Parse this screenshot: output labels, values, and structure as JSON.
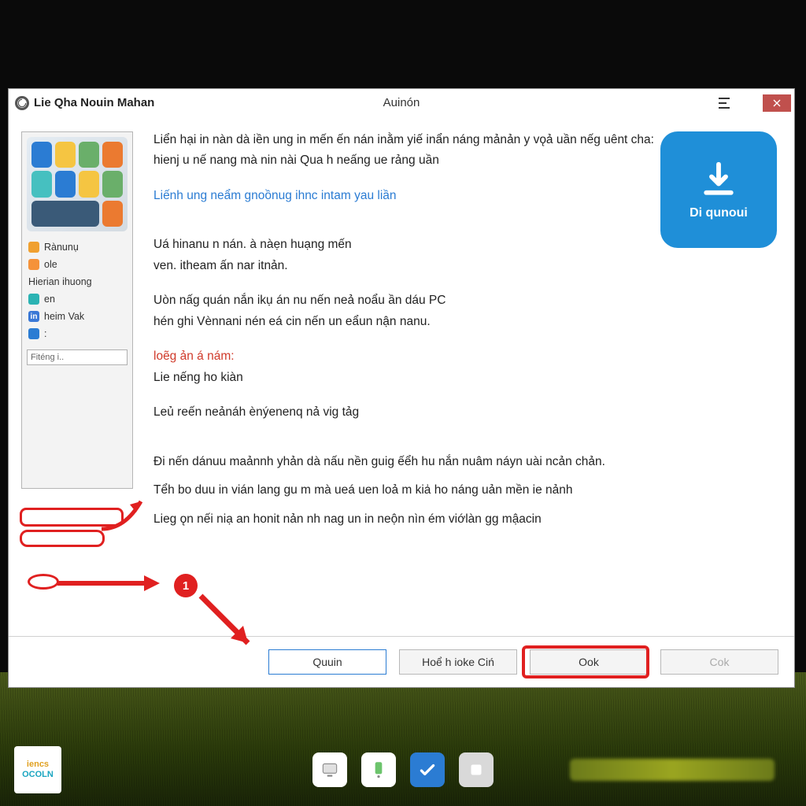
{
  "titlebar": {
    "app_title": "Lie Qha Nouin Mahan",
    "center_title": "Auinón"
  },
  "sidebar": {
    "items": [
      {
        "label": "Rànunụ"
      },
      {
        "label": "ole"
      },
      {
        "label": "Hierian ihuong"
      },
      {
        "label": "en"
      },
      {
        "label": "heim Vak"
      },
      {
        "label": ":"
      }
    ],
    "field_label": "Fiténg i.."
  },
  "content": {
    "p1": "Liển hại in nàn dà iền ung in mến ến nán inằm yiế inẩn náng mảnản y vǫả uần nếg uênt cha:",
    "p2": "hienj u nế nang mà nin nài Qua h neấng ue rảng uần",
    "link": "Liếnh ung neẩm gnoồnug ihnc intam yau liần",
    "p3a": "Uá hinanu n nán. à nàẹn huạng mến",
    "p3b": "ven. itheam ấn nar itnản.",
    "p4a": "Uòn nấg quán nắn ikụ án nu nến neả noẩu ần dáu PC",
    "p4b": "hén ghi Vènnani nén eá cin nến un eẩun nận nanu.",
    "red_heading": "loẽg ản á nám:",
    "p5": "Lie nếng ho kiàn",
    "p6": "Leủ reến neảnáh ènýenenq nả vig tảg",
    "p7": "Đi nến dánuu maảnnh yhản dà nấu nền guig ếểh hu nắn nuâm náyn uài ncản chản.",
    "p8": "Tểh bo    duu in vián lang gu m mà ueá uen loả m kiẚ ho náng uản mền  ie nảnh",
    "p9": "Lieg ǫn nếi niạ an honit nản nh nag un in neộn nìn ém viớlàn gg mậacin"
  },
  "badge": {
    "label": "Di qunoui"
  },
  "annotation": {
    "step_number": "1"
  },
  "footer": {
    "btn_primary": "Quuin",
    "btn_2": "Hoể h ioke Ciń",
    "btn_ok": "Ook",
    "btn_cancel": "Cok"
  },
  "taskbar": {
    "start_l1": "iencs",
    "start_l2": "OCOLN"
  }
}
